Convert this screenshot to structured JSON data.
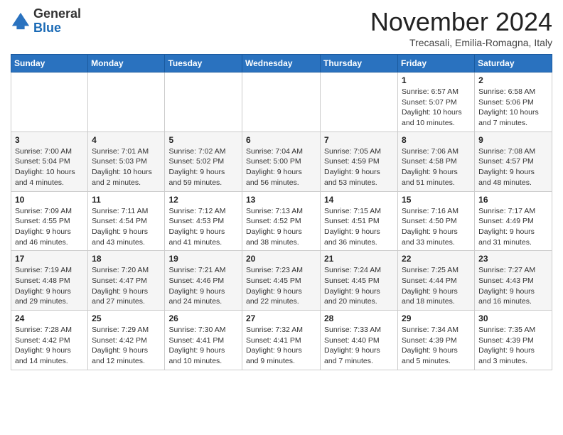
{
  "logo": {
    "general": "General",
    "blue": "Blue"
  },
  "header": {
    "month": "November 2024",
    "location": "Trecasali, Emilia-Romagna, Italy"
  },
  "days_of_week": [
    "Sunday",
    "Monday",
    "Tuesday",
    "Wednesday",
    "Thursday",
    "Friday",
    "Saturday"
  ],
  "weeks": [
    [
      {
        "day": "",
        "info": ""
      },
      {
        "day": "",
        "info": ""
      },
      {
        "day": "",
        "info": ""
      },
      {
        "day": "",
        "info": ""
      },
      {
        "day": "",
        "info": ""
      },
      {
        "day": "1",
        "info": "Sunrise: 6:57 AM\nSunset: 5:07 PM\nDaylight: 10 hours and 10 minutes."
      },
      {
        "day": "2",
        "info": "Sunrise: 6:58 AM\nSunset: 5:06 PM\nDaylight: 10 hours and 7 minutes."
      }
    ],
    [
      {
        "day": "3",
        "info": "Sunrise: 7:00 AM\nSunset: 5:04 PM\nDaylight: 10 hours and 4 minutes."
      },
      {
        "day": "4",
        "info": "Sunrise: 7:01 AM\nSunset: 5:03 PM\nDaylight: 10 hours and 2 minutes."
      },
      {
        "day": "5",
        "info": "Sunrise: 7:02 AM\nSunset: 5:02 PM\nDaylight: 9 hours and 59 minutes."
      },
      {
        "day": "6",
        "info": "Sunrise: 7:04 AM\nSunset: 5:00 PM\nDaylight: 9 hours and 56 minutes."
      },
      {
        "day": "7",
        "info": "Sunrise: 7:05 AM\nSunset: 4:59 PM\nDaylight: 9 hours and 53 minutes."
      },
      {
        "day": "8",
        "info": "Sunrise: 7:06 AM\nSunset: 4:58 PM\nDaylight: 9 hours and 51 minutes."
      },
      {
        "day": "9",
        "info": "Sunrise: 7:08 AM\nSunset: 4:57 PM\nDaylight: 9 hours and 48 minutes."
      }
    ],
    [
      {
        "day": "10",
        "info": "Sunrise: 7:09 AM\nSunset: 4:55 PM\nDaylight: 9 hours and 46 minutes."
      },
      {
        "day": "11",
        "info": "Sunrise: 7:11 AM\nSunset: 4:54 PM\nDaylight: 9 hours and 43 minutes."
      },
      {
        "day": "12",
        "info": "Sunrise: 7:12 AM\nSunset: 4:53 PM\nDaylight: 9 hours and 41 minutes."
      },
      {
        "day": "13",
        "info": "Sunrise: 7:13 AM\nSunset: 4:52 PM\nDaylight: 9 hours and 38 minutes."
      },
      {
        "day": "14",
        "info": "Sunrise: 7:15 AM\nSunset: 4:51 PM\nDaylight: 9 hours and 36 minutes."
      },
      {
        "day": "15",
        "info": "Sunrise: 7:16 AM\nSunset: 4:50 PM\nDaylight: 9 hours and 33 minutes."
      },
      {
        "day": "16",
        "info": "Sunrise: 7:17 AM\nSunset: 4:49 PM\nDaylight: 9 hours and 31 minutes."
      }
    ],
    [
      {
        "day": "17",
        "info": "Sunrise: 7:19 AM\nSunset: 4:48 PM\nDaylight: 9 hours and 29 minutes."
      },
      {
        "day": "18",
        "info": "Sunrise: 7:20 AM\nSunset: 4:47 PM\nDaylight: 9 hours and 27 minutes."
      },
      {
        "day": "19",
        "info": "Sunrise: 7:21 AM\nSunset: 4:46 PM\nDaylight: 9 hours and 24 minutes."
      },
      {
        "day": "20",
        "info": "Sunrise: 7:23 AM\nSunset: 4:45 PM\nDaylight: 9 hours and 22 minutes."
      },
      {
        "day": "21",
        "info": "Sunrise: 7:24 AM\nSunset: 4:45 PM\nDaylight: 9 hours and 20 minutes."
      },
      {
        "day": "22",
        "info": "Sunrise: 7:25 AM\nSunset: 4:44 PM\nDaylight: 9 hours and 18 minutes."
      },
      {
        "day": "23",
        "info": "Sunrise: 7:27 AM\nSunset: 4:43 PM\nDaylight: 9 hours and 16 minutes."
      }
    ],
    [
      {
        "day": "24",
        "info": "Sunrise: 7:28 AM\nSunset: 4:42 PM\nDaylight: 9 hours and 14 minutes."
      },
      {
        "day": "25",
        "info": "Sunrise: 7:29 AM\nSunset: 4:42 PM\nDaylight: 9 hours and 12 minutes."
      },
      {
        "day": "26",
        "info": "Sunrise: 7:30 AM\nSunset: 4:41 PM\nDaylight: 9 hours and 10 minutes."
      },
      {
        "day": "27",
        "info": "Sunrise: 7:32 AM\nSunset: 4:41 PM\nDaylight: 9 hours and 9 minutes."
      },
      {
        "day": "28",
        "info": "Sunrise: 7:33 AM\nSunset: 4:40 PM\nDaylight: 9 hours and 7 minutes."
      },
      {
        "day": "29",
        "info": "Sunrise: 7:34 AM\nSunset: 4:39 PM\nDaylight: 9 hours and 5 minutes."
      },
      {
        "day": "30",
        "info": "Sunrise: 7:35 AM\nSunset: 4:39 PM\nDaylight: 9 hours and 3 minutes."
      }
    ]
  ]
}
